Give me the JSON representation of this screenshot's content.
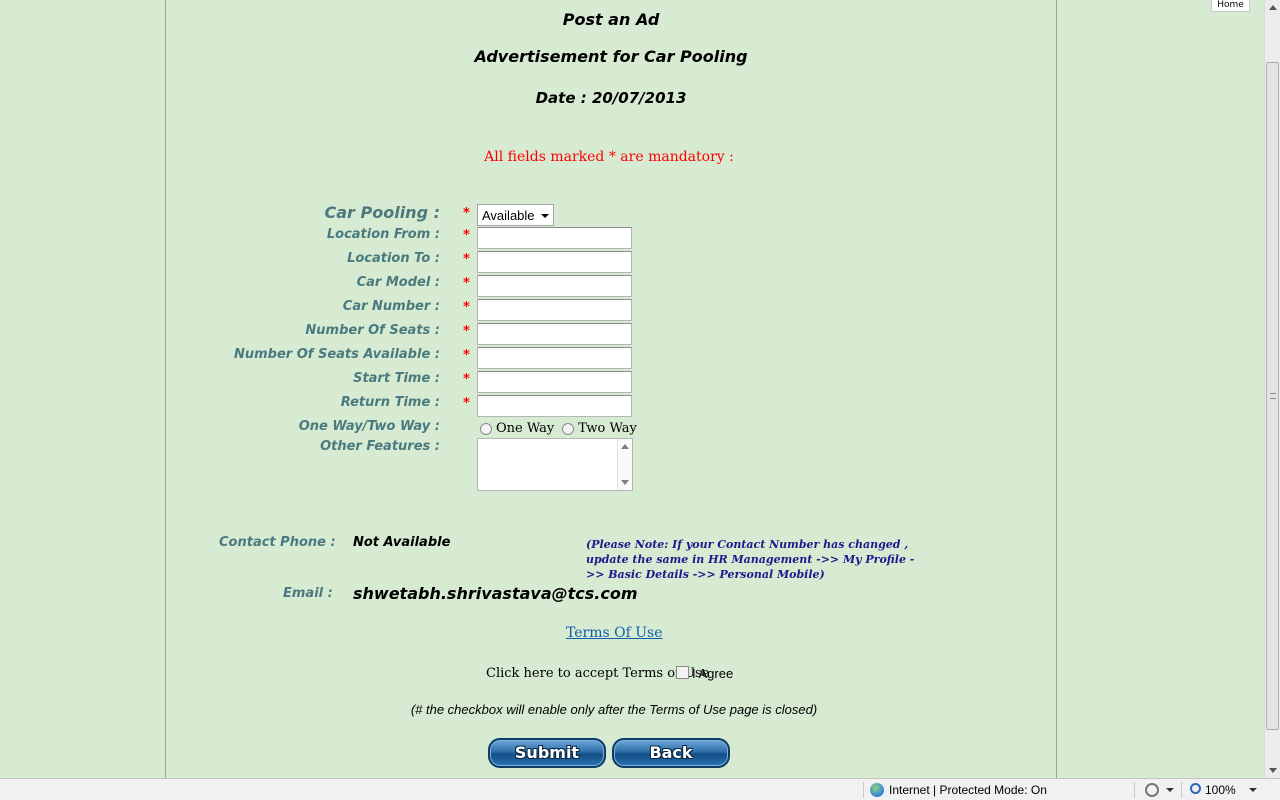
{
  "header": {
    "home_label": "Home",
    "title": "Post an Ad",
    "subtitle": "Advertisement for Car Pooling",
    "date_text": "Date : 20/07/2013"
  },
  "mandatory_note": "All fields marked * are mandatory :",
  "form": {
    "car_pooling_label": "Car Pooling :",
    "car_pooling_value": "Available",
    "fields": [
      {
        "label": "Location From :",
        "value": ""
      },
      {
        "label": "Location To :",
        "value": ""
      },
      {
        "label": "Car Model :",
        "value": ""
      },
      {
        "label": "Car Number :",
        "value": ""
      },
      {
        "label": "Number Of Seats :",
        "value": ""
      },
      {
        "label": "Number Of Seats Available :",
        "value": ""
      },
      {
        "label": "Start Time :",
        "value": ""
      },
      {
        "label": "Return Time :",
        "value": ""
      }
    ],
    "trip_type_label": "One Way/Two Way :",
    "trip_type_options": [
      "One Way",
      "Two Way"
    ],
    "other_features_label": "Other Features :",
    "required_marker": "*"
  },
  "contact": {
    "phone_label": "Contact Phone :",
    "phone_value": "Not Available",
    "note": "(Please Note: If your Contact Number has changed , update the same in HR Management ->> My Profile ->> Basic Details ->> Personal Mobile)",
    "email_label": "Email :",
    "email_value": "shwetabh.shrivastava@tcs.com"
  },
  "terms": {
    "link_text": "Terms Of Use",
    "accept_text": "Click here to accept Terms of Use",
    "agree_label": "I Agree",
    "hint": "(# the checkbox will enable only after the Terms of Use page is closed)"
  },
  "buttons": {
    "submit": "Submit",
    "back": "Back"
  },
  "statusbar": {
    "zone": "Internet | Protected Mode: On",
    "zoom": "100%"
  }
}
